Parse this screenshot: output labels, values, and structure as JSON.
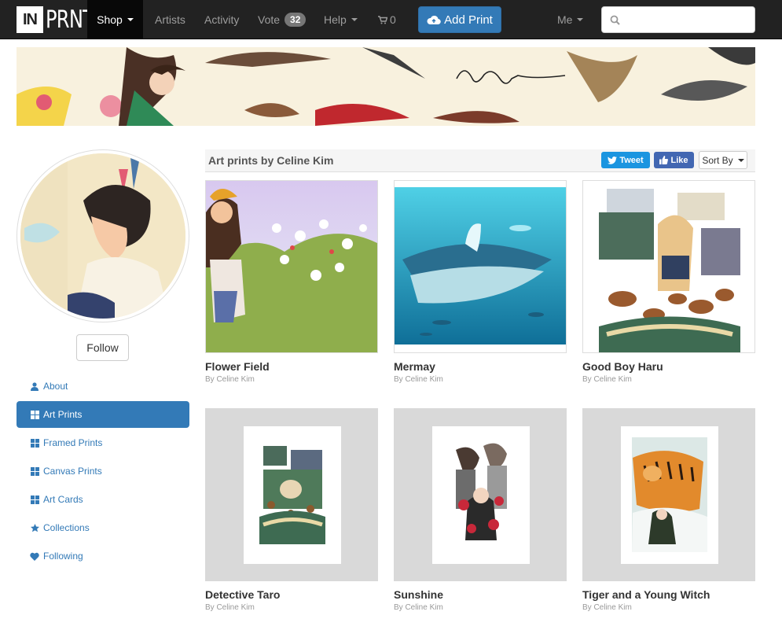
{
  "brand": {
    "logo_in": "IN",
    "logo_prnt": "PRNT"
  },
  "nav": {
    "shop": "Shop",
    "artists": "Artists",
    "activity": "Activity",
    "vote": "Vote",
    "vote_count": "32",
    "help": "Help",
    "cart_count": "0",
    "add_print": "Add Print",
    "me": "Me"
  },
  "search": {
    "placeholder": ""
  },
  "banner": {
    "signature": "Celine Kim"
  },
  "sidebar": {
    "follow": "Follow",
    "items": [
      {
        "label": "About",
        "icon": "user-icon"
      },
      {
        "label": "Art Prints",
        "icon": "grid-icon",
        "active": true
      },
      {
        "label": "Framed Prints",
        "icon": "grid-icon"
      },
      {
        "label": "Canvas Prints",
        "icon": "grid-icon"
      },
      {
        "label": "Art Cards",
        "icon": "grid-icon"
      },
      {
        "label": "Collections",
        "icon": "star-icon"
      },
      {
        "label": "Following",
        "icon": "heart-icon"
      }
    ]
  },
  "content": {
    "heading": "Art prints by Celine Kim",
    "tweet": "Tweet",
    "like": "Like",
    "sort_by": "Sort By",
    "prints": [
      {
        "title": "Flower Field",
        "by": "By Celine Kim"
      },
      {
        "title": "Mermay",
        "by": "By Celine Kim"
      },
      {
        "title": "Good Boy Haru",
        "by": "By Celine Kim"
      },
      {
        "title": "Detective Taro",
        "by": "By Celine Kim"
      },
      {
        "title": "Sunshine",
        "by": "By Celine Kim"
      },
      {
        "title": "Tiger and a Young Witch",
        "by": "By Celine Kim"
      }
    ]
  },
  "colors": {
    "navbar": "#222222",
    "primary": "#337ab7",
    "twitter": "#1b95e0",
    "facebook": "#4267b2"
  }
}
